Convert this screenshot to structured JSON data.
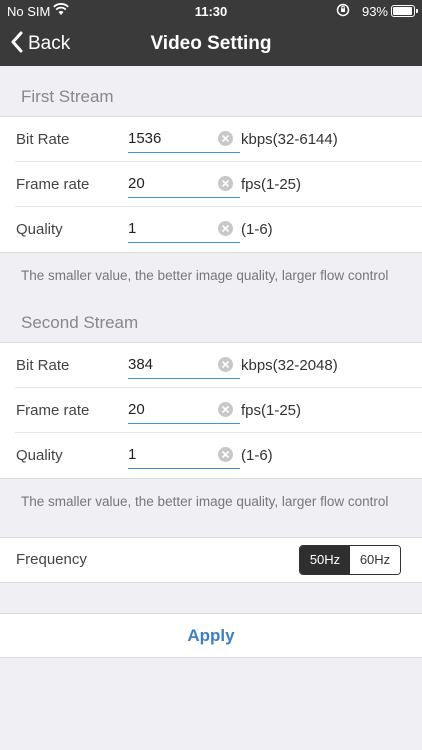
{
  "status_bar": {
    "carrier": "No SIM",
    "time": "11:30",
    "battery": "93%",
    "icons": [
      "wifi-icon",
      "orientation-lock-icon",
      "battery-icon"
    ]
  },
  "nav": {
    "back_label": "Back",
    "title": "Video Setting",
    "back_icon": "chevron-left-icon"
  },
  "first_stream": {
    "header": "First Stream",
    "bit_rate": {
      "label": "Bit Rate",
      "value": "1536",
      "unit": "kbps(32-6144)"
    },
    "frame_rate": {
      "label": "Frame rate",
      "value": "20",
      "unit": "fps(1-25)"
    },
    "quality": {
      "label": "Quality",
      "value": "1",
      "unit": "(1-6)"
    },
    "note": "The smaller value, the better image quality, larger flow control"
  },
  "second_stream": {
    "header": "Second Stream",
    "bit_rate": {
      "label": "Bit Rate",
      "value": "384",
      "unit": "kbps(32-2048)"
    },
    "frame_rate": {
      "label": "Frame rate",
      "value": "20",
      "unit": "fps(1-25)"
    },
    "quality": {
      "label": "Quality",
      "value": "1",
      "unit": "(1-6)"
    },
    "note": "The smaller value, the better image quality, larger flow control"
  },
  "frequency": {
    "label": "Frequency",
    "options": [
      "50Hz",
      "60Hz"
    ],
    "selected": "50Hz"
  },
  "apply_label": "Apply",
  "colors": {
    "nav_bg": "#3a3a3a",
    "accent": "#3d7fc1",
    "field_underline": "#4a90d9",
    "page_bg": "#efeff4"
  }
}
